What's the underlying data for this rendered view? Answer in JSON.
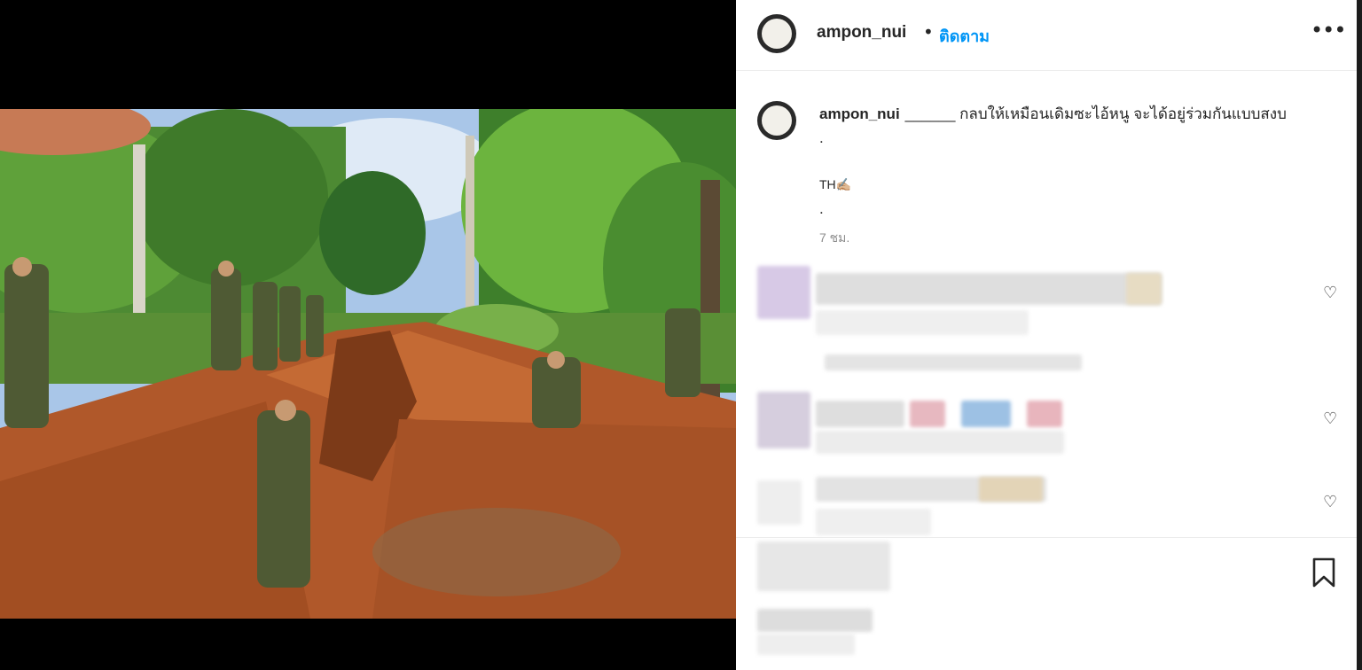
{
  "post": {
    "username": "ampon_nui",
    "separator": "•",
    "follow_label": "ติดตาม",
    "more_icon": "more-horizontal-icon",
    "caption": "______ กลบให้เหมือนเดิมซะไอ้หนู จะได้อยู่ร่วมกันแบบสงบ",
    "caption_line2": ".",
    "caption_line3": "TH✍🏼",
    "caption_line4": ".",
    "timestamp": "7 ชม.",
    "avatar_text": "ampon"
  },
  "comments": [
    {
      "heart_icon": "heart-outline-icon"
    },
    {
      "heart_icon": "heart-outline-icon"
    },
    {
      "heart_icon": "heart-outline-icon"
    }
  ],
  "footer": {
    "bookmark_icon": "bookmark-icon"
  },
  "colors": {
    "follow_blue": "#0095f6",
    "text": "#262626",
    "muted": "#8e8e8e"
  }
}
